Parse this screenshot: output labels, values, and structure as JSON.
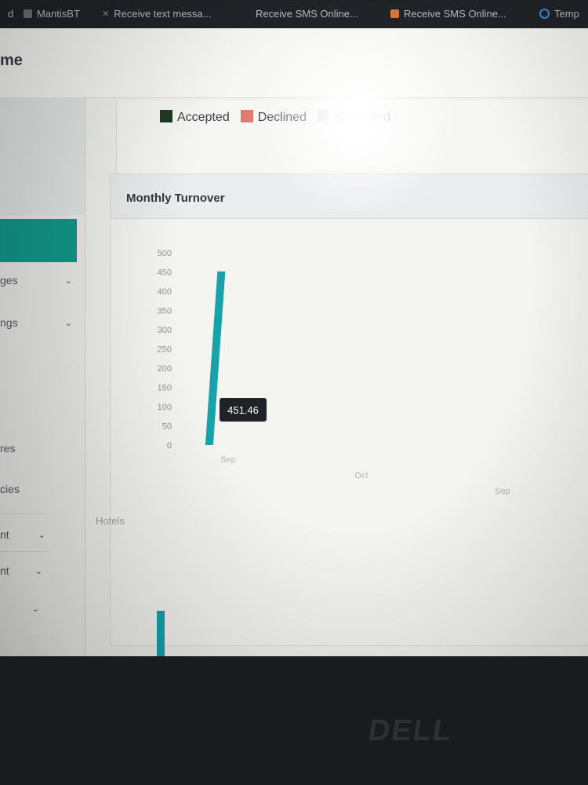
{
  "tabs": [
    {
      "label": "d",
      "icon": "page-icon"
    },
    {
      "label": "MantisBT",
      "icon": "mantis-icon"
    },
    {
      "label": "Receive text messa...",
      "icon": "sms-icon"
    },
    {
      "label": "Receive SMS Online...",
      "icon": "sms-icon"
    },
    {
      "label": "Receive SMS Online...",
      "icon": "sms-orange-icon"
    },
    {
      "label": "Temp",
      "icon": "loading-icon"
    }
  ],
  "app": {
    "brand": "me"
  },
  "sidebar": {
    "items": [
      {
        "label": "ges",
        "has_chevron": true
      },
      {
        "label": "ngs",
        "has_chevron": true
      },
      {
        "label": "res",
        "has_chevron": false
      },
      {
        "label": "cies",
        "has_chevron": false
      },
      {
        "label": "nt",
        "has_chevron": true
      },
      {
        "label": "nt",
        "has_chevron": true
      },
      {
        "label": "",
        "has_chevron": true
      }
    ]
  },
  "legend": {
    "items": [
      {
        "label": "Accepted",
        "color": "#1f3a23"
      },
      {
        "label": "Declined",
        "color": "#e07a72"
      },
      {
        "label": "Cancelled",
        "color": "#c9ccd0"
      }
    ]
  },
  "monthly_panel": {
    "title": "Monthly Turnover"
  },
  "tooltip": {
    "value": "451.46"
  },
  "next_panel": {
    "label": "Hotels"
  },
  "colors": {
    "accent": "#139a8c",
    "bar": "#17a3a8"
  },
  "chart_data": {
    "type": "bar",
    "title": "Monthly Turnover",
    "categories": [
      "Sep",
      "Oct",
      "Sep"
    ],
    "values": [
      451.46,
      0,
      0
    ],
    "yticks": [
      500,
      450,
      400,
      350,
      300,
      250,
      200,
      150,
      100,
      50,
      0
    ],
    "ylim": [
      0,
      500
    ],
    "xlabel": "",
    "ylabel": ""
  },
  "brand_logo": "DELL"
}
